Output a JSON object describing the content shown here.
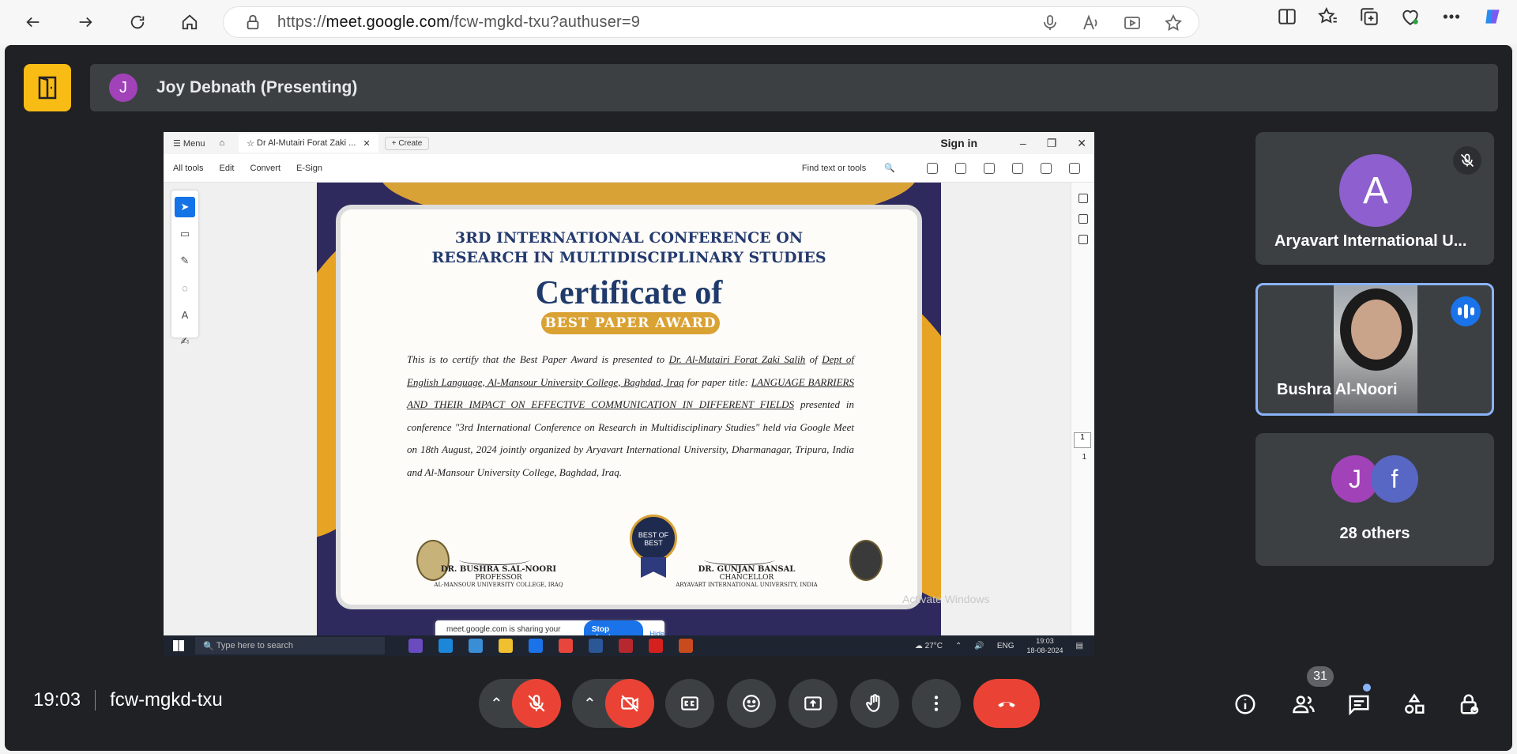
{
  "browser": {
    "url_prefix": "https://",
    "url_host": "meet.google.com",
    "url_path": "/fcw-mgkd-txu?authuser=9"
  },
  "meet": {
    "presenter_initial": "J",
    "presenter_label": "Joy Debnath (Presenting)",
    "meeting_time": "19:03",
    "meeting_code": "fcw-mgkd-txu",
    "participant_count": "31"
  },
  "acrobat": {
    "menu_label": "Menu",
    "tab_title": "Dr Al-Mutairi Forat Zaki ...",
    "create_label": "Create",
    "sign_in": "Sign in",
    "tools": [
      "All tools",
      "Edit",
      "Convert",
      "E-Sign"
    ],
    "find_label": "Find text or tools",
    "page_number": "1",
    "page_total": "1"
  },
  "certificate": {
    "heading_line1": "3RD INTERNATIONAL CONFERENCE ON",
    "heading_line2": "RESEARCH IN MULTIDISCIPLINARY STUDIES",
    "title": "Certificate of",
    "ribbon": "BEST PAPER AWARD",
    "body_intro": "This is to certify that the Best Paper Award is presented to ",
    "recipient": "Dr. Al-Mutairi Forat Zaki Salih",
    "body_of": " of ",
    "affiliation": "Dept of English Language, Al-Mansour University College, Baghdad, Iraq",
    "body_for": " for paper title: ",
    "paper_title": "LANGUAGE BARRIERS AND THEIR IMPACT ON EFFECTIVE COMMUNICATION IN DIFFERENT FIELDS",
    "body_rest": " presented in conference \"3rd International Conference on Research in Multidisciplinary Studies\" held via Google Meet on 18th August, 2024 jointly organized by Aryavart International University, Dharmanagar, Tripura, India and Al-Mansour University College, Baghdad, Iraq.",
    "medal_text": "BEST OF BEST",
    "signer1_name": "DR. BUSHRA S.AL-NOORI",
    "signer1_role": "PROFESSOR",
    "signer1_org": "AL-MANSOUR UNIVERSITY COLLEGE, IRAQ",
    "signer2_name": "DR. GUNJAN BANSAL",
    "signer2_role": "CHANCELLOR",
    "signer2_org": "ARYAVART INTERNATIONAL UNIVERSITY, INDIA"
  },
  "share_notice": {
    "text": "meet.google.com is sharing your screen.",
    "stop": "Stop sharing",
    "hide": "Hide"
  },
  "watermark": "Activate Windows",
  "taskbar": {
    "search_placeholder": "Type here to search",
    "weather": "27°C",
    "lang": "ENG",
    "clock_time": "19:03",
    "clock_date": "18-08-2024"
  },
  "participants": {
    "tile1_initial": "A",
    "tile1_name": "Aryavart International U...",
    "tile2_name": "Bushra Al-Noori",
    "tile3_av1": "J",
    "tile3_av2": "f",
    "tile3_others": "28 others"
  },
  "colors": {
    "meet_bg": "#202124",
    "tile_bg": "#3c4043",
    "red": "#ea4335",
    "accent_blue": "#8ab4f8",
    "exit_yellow": "#f9bc15"
  }
}
